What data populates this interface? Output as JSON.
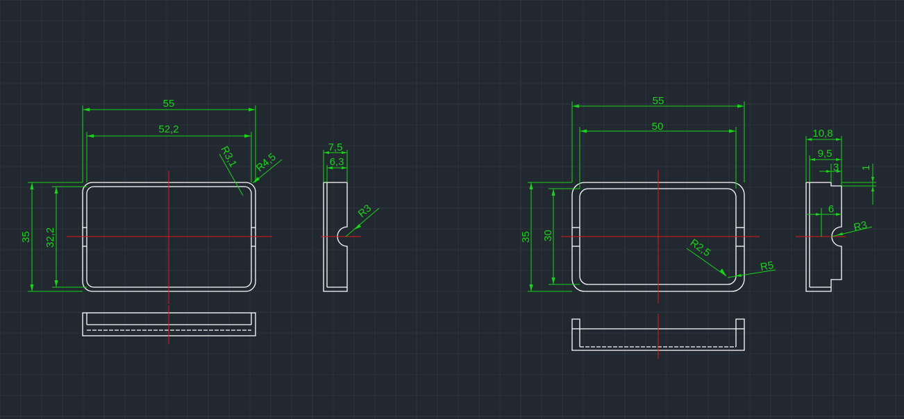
{
  "colors": {
    "background": "#212830",
    "grid_minor": "#2a323c",
    "grid_major": "#2f3946",
    "outline": "#ffffff",
    "center_line": "#e01a1a",
    "dimension": "#19d419"
  },
  "part_left": {
    "dims": {
      "width_outer": "55",
      "width_inner": "52,2",
      "radius_inner": "R3,1",
      "radius_outer": "R4,5",
      "height_outer": "35",
      "height_inner": "32,2",
      "side_width_outer": "7,5",
      "side_width_inner": "6,3",
      "side_notch_radius": "R3"
    }
  },
  "part_right": {
    "dims": {
      "width_outer": "55",
      "width_inner": "50",
      "height_outer": "35",
      "height_inner": "30",
      "radius_inner": "R2,5",
      "radius_outer": "R5",
      "side_width_outer": "10,8",
      "side_width_inner": "9,5",
      "side_step": "3",
      "side_step_height": "1",
      "side_notch_offset": "6",
      "side_notch_radius": "R3"
    }
  }
}
